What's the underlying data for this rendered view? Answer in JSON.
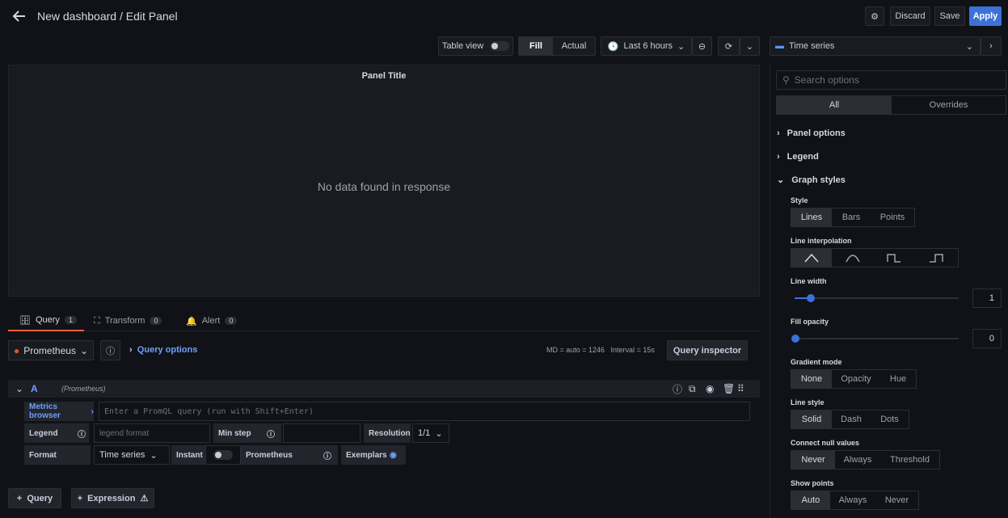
{
  "header": {
    "title": "New dashboard / Edit Panel",
    "discard": "Discard",
    "save": "Save",
    "apply": "Apply"
  },
  "toolbar": {
    "table_view": "Table view",
    "fill": "Fill",
    "actual": "Actual",
    "time_range": "Last 6 hours",
    "viz": "Time series"
  },
  "panel": {
    "title": "Panel Title",
    "empty": "No data found in response"
  },
  "tabs": [
    {
      "label": "Query",
      "count": "1"
    },
    {
      "label": "Transform",
      "count": "0"
    },
    {
      "label": "Alert",
      "count": "0"
    }
  ],
  "query_row": {
    "datasource": "Prometheus",
    "options": "Query options",
    "info": "MD = auto = 1246   Interval = 15s",
    "inspector": "Query inspector"
  },
  "query": {
    "ref": "A",
    "ds": "(Prometheus)",
    "metrics_browser": "Metrics browser",
    "placeholder": "Enter a PromQL query (run with Shift+Enter)",
    "legend_label": "Legend",
    "legend_placeholder": "legend format",
    "min_step_label": "Min step",
    "resolution_label": "Resolution",
    "resolution_value": "1/1",
    "format_label": "Format",
    "format_value": "Time series",
    "instant_label": "Instant",
    "prometheus_label": "Prometheus",
    "exemplars_label": "Exemplars"
  },
  "add": {
    "query": "Query",
    "expression": "Expression"
  },
  "sidebar": {
    "search_placeholder": "Search options",
    "tab_all": "All",
    "tab_overrides": "Overrides",
    "panel_options": "Panel options",
    "legend": "Legend",
    "graph_styles": "Graph styles",
    "style_label": "Style",
    "style_opts": [
      "Lines",
      "Bars",
      "Points"
    ],
    "interp_label": "Line interpolation",
    "line_width_label": "Line width",
    "line_width": "1",
    "fill_opacity_label": "Fill opacity",
    "fill_opacity": "0",
    "gradient_label": "Gradient mode",
    "gradient_opts": [
      "None",
      "Opacity",
      "Hue"
    ],
    "line_style_label": "Line style",
    "line_style_opts": [
      "Solid",
      "Dash",
      "Dots"
    ],
    "connect_label": "Connect null values",
    "connect_opts": [
      "Never",
      "Always",
      "Threshold"
    ],
    "points_label": "Show points",
    "points_opts": [
      "Auto",
      "Always",
      "Never"
    ]
  },
  "colors": {
    "accent": "#3d71d9",
    "tab_active": "#f55f3e",
    "datasource": "#e6522c"
  }
}
